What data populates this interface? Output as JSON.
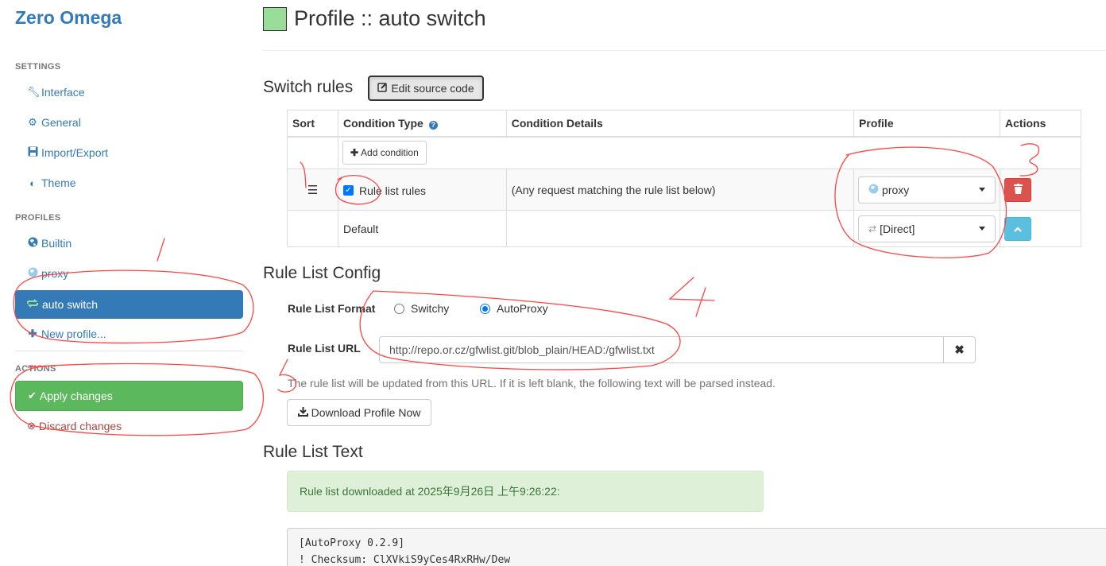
{
  "sidebar": {
    "brand": "Zero Omega",
    "settings_title": "SETTINGS",
    "settings_items": [
      {
        "label": "Interface",
        "icon": "wrench-icon"
      },
      {
        "label": "General",
        "icon": "gear-icon"
      },
      {
        "label": "Import/Export",
        "icon": "floppy-icon"
      },
      {
        "label": "Theme",
        "icon": "contrast-icon"
      }
    ],
    "profiles_title": "PROFILES",
    "profile_items": [
      {
        "label": "Builtin",
        "icon": "globe-icon"
      },
      {
        "label": "proxy",
        "icon": "globe-icon"
      },
      {
        "label": "auto switch",
        "icon": "switch-icon",
        "active": true
      },
      {
        "label": "New profile...",
        "icon": "plus-icon"
      }
    ],
    "actions_title": "ACTIONS",
    "apply_label": "Apply changes",
    "discard_label": "Discard changes"
  },
  "header": {
    "title": "Profile :: auto switch",
    "profile_color": "#99dd99"
  },
  "switch_rules": {
    "heading": "Switch rules",
    "edit_source_label": "Edit source code",
    "columns": [
      "Sort",
      "Condition Type",
      "Condition Details",
      "Profile",
      "Actions"
    ],
    "add_condition_label": "Add condition",
    "rows": [
      {
        "condition_type": "Rule list rules",
        "checked": true,
        "details": "(Any request matching the rule list below)",
        "profile": "proxy"
      },
      {
        "condition_type": "Default",
        "details": "",
        "profile": "[Direct]"
      }
    ]
  },
  "rule_list_config": {
    "heading": "Rule List Config",
    "format_label": "Rule List Format",
    "format_options": [
      "Switchy",
      "AutoProxy"
    ],
    "format_selected": "AutoProxy",
    "url_label": "Rule List URL",
    "url_value": "http://repo.or.cz/gfwlist.git/blob_plain/HEAD:/gfwlist.txt",
    "help_text": "The rule list will be updated from this URL. If it is left blank, the following text will be parsed instead.",
    "download_label": "Download Profile Now"
  },
  "rule_list_text": {
    "heading": "Rule List Text",
    "alert": "Rule list downloaded at 2025年9月26日 上午9:26:22:",
    "lines": [
      "[AutoProxy 0.2.9]",
      "! Checksum: ClXVkiS9yCes4RxRHw/Dew"
    ]
  },
  "annotations": {
    "color": "#ff4444",
    "labels": [
      "1",
      "2",
      "3",
      "4",
      "5"
    ]
  }
}
